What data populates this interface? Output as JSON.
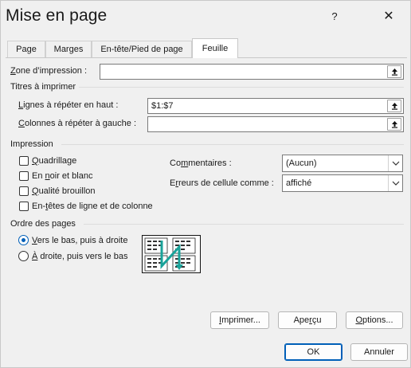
{
  "dialog": {
    "title": "Mise en page",
    "help_label": "?",
    "close_label": "✕"
  },
  "tabs": [
    {
      "label": "Page",
      "active": false
    },
    {
      "label": "Marges",
      "active": false
    },
    {
      "label": "En-tête/Pied de page",
      "active": false
    },
    {
      "label": "Feuille",
      "active": true
    }
  ],
  "print_area": {
    "label": "one d’impression :",
    "label_accel": "Z",
    "value": ""
  },
  "print_titles": {
    "group_title": "Titres à imprimer",
    "rows": {
      "label_accel": "L",
      "label": "ignes à répéter en haut :",
      "value": "$1:$7"
    },
    "cols": {
      "label_accel": "C",
      "label": "olonnes à répéter à gauche :",
      "value": ""
    }
  },
  "print": {
    "group_title": "Impression",
    "gridlines": {
      "accel": "Q",
      "label": "uadrillage",
      "checked": false
    },
    "black_white": {
      "pre": "En ",
      "accel": "n",
      "label": "oir et blanc",
      "checked": false
    },
    "draft": {
      "accel": "Q",
      "label": "ualité brouillon",
      "checked": false
    },
    "headings": {
      "pre": "En-",
      "accel": "t",
      "label": "êtes de ligne et de colonne",
      "checked": false
    },
    "comments": {
      "pre": "Co",
      "accel": "m",
      "label": "mentaires :",
      "value": "(Aucun)"
    },
    "errors": {
      "pre": "E",
      "accel": "r",
      "label": "reurs de cellule comme :",
      "value": "affiché"
    }
  },
  "page_order": {
    "group_title": "Ordre des pages",
    "down_then_over": {
      "accel": "V",
      "label": "ers le bas, puis à droite",
      "selected": true
    },
    "over_then_down": {
      "accel": "À",
      "label": " droite, puis vers le bas",
      "selected": false
    }
  },
  "buttons": {
    "print": {
      "accel": "I",
      "label": "mprimer..."
    },
    "preview": {
      "pre": "Ape",
      "accel": "r",
      "label": "çu"
    },
    "options": {
      "accel": "O",
      "label": "ptions..."
    },
    "ok": "OK",
    "cancel": "Annuler"
  },
  "colors": {
    "accent": "#005fb8",
    "page_order_arrow": "#1aa39a"
  }
}
